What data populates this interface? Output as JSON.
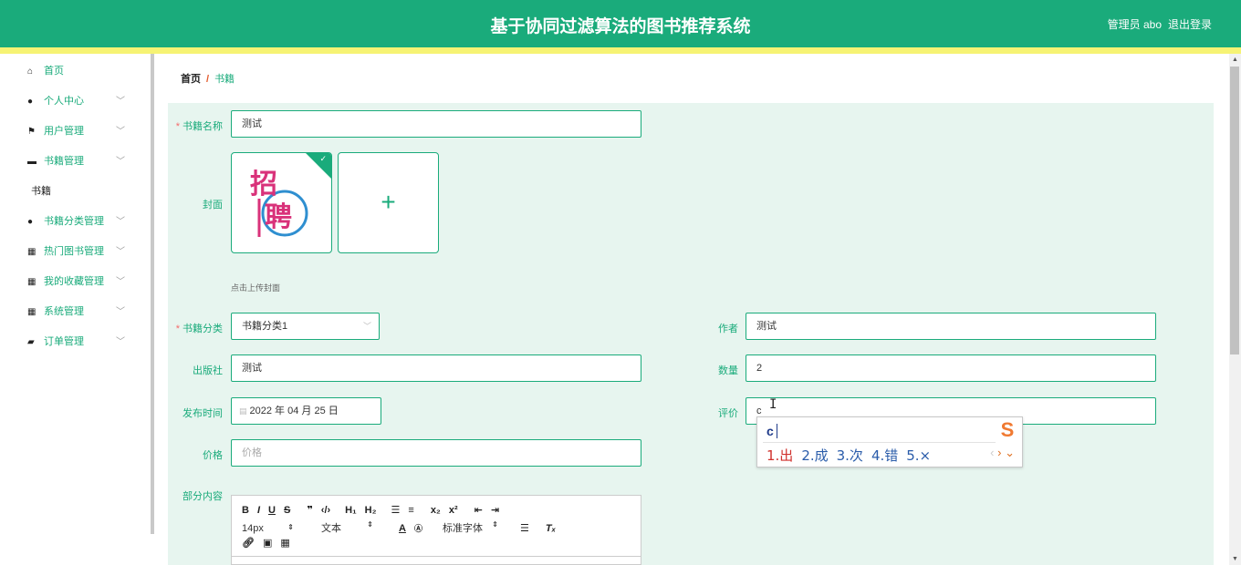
{
  "header": {
    "title": "基于协同过滤算法的图书推荐系统",
    "user": "管理员 abo",
    "logout": "退出登录"
  },
  "sidebar": {
    "items": [
      {
        "icon": "home-icon",
        "label": "首页",
        "chevron": false
      },
      {
        "icon": "user-icon",
        "label": "个人中心",
        "chevron": true
      },
      {
        "icon": "flag-icon",
        "label": "用户管理",
        "chevron": true
      },
      {
        "icon": "briefcase-icon",
        "label": "书籍管理",
        "chevron": true
      },
      {
        "icon": "",
        "label": "书籍",
        "chevron": false
      },
      {
        "icon": "user-icon",
        "label": "书籍分类管理",
        "chevron": true
      },
      {
        "icon": "grid-icon",
        "label": "热门图书管理",
        "chevron": true
      },
      {
        "icon": "grid-icon",
        "label": "我的收藏管理",
        "chevron": true
      },
      {
        "icon": "grid-icon",
        "label": "系统管理",
        "chevron": true
      },
      {
        "icon": "wallet-icon",
        "label": "订单管理",
        "chevron": true
      }
    ]
  },
  "breadcrumb": {
    "home": "首页",
    "sep": "/",
    "current": "书籍"
  },
  "form": {
    "name_label": "书籍名称",
    "name_value": "测试",
    "cover_label": "封面",
    "cover_tip": "点击上传封面",
    "category_label": "书籍分类",
    "category_value": "书籍分类1",
    "author_label": "作者",
    "author_value": "测试",
    "publisher_label": "出版社",
    "publisher_value": "测试",
    "quantity_label": "数量",
    "quantity_value": "2",
    "date_label": "发布时间",
    "date_value": "2022 年 04 月 25 日",
    "rating_label": "评价",
    "rating_value": "c",
    "price_label": "价格",
    "price_placeholder": "价格",
    "content_label": "部分内容"
  },
  "editor": {
    "font_size": "14px",
    "paragraph": "文本",
    "font_family": "标准字体"
  },
  "ime": {
    "composition": "c",
    "candidates": [
      "1.出",
      "2.成",
      "3.次",
      "4.错",
      "5.×"
    ]
  },
  "colors": {
    "primary": "#1aab7b",
    "accent_bar": "#f6f374",
    "panel": "#e7f5ef"
  }
}
